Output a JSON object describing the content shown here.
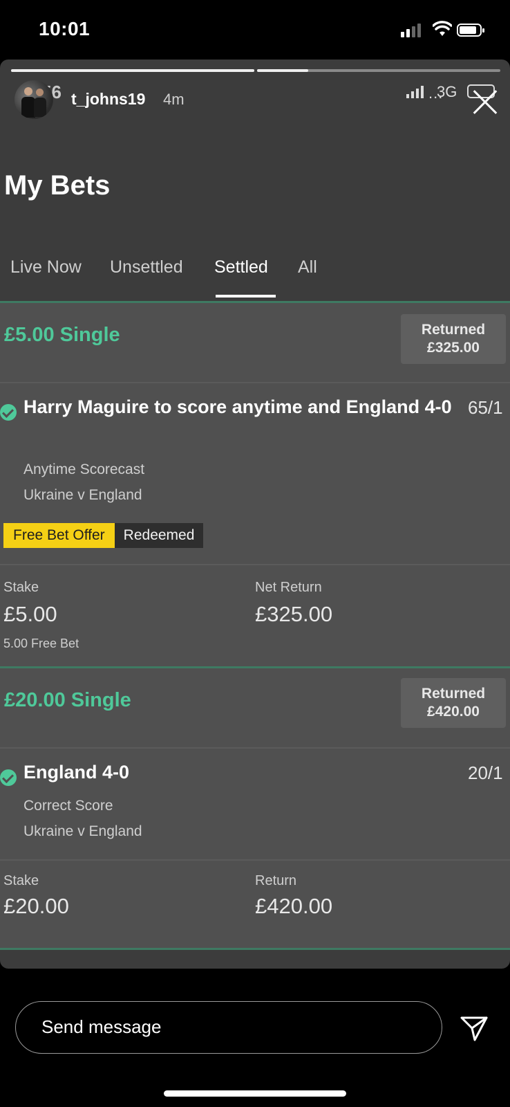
{
  "status_bar": {
    "time": "10:01"
  },
  "story": {
    "ghost_time": "56",
    "username": "t_johns19",
    "posted_ago": "4m",
    "ghost_network": "3G"
  },
  "app": {
    "title": "My Bets",
    "tabs": [
      "Live Now",
      "Unsettled",
      "Settled",
      "All"
    ],
    "active_tab": "Settled",
    "accent_color": "#4fc99a"
  },
  "bets": [
    {
      "title": "£5.00 Single",
      "status_label": "Returned",
      "status_amount": "£325.00",
      "selection": "Harry Maguire to score anytime and England 4-0",
      "odds": "65/1",
      "market": "Anytime Scorecast",
      "event": "Ukraine v England",
      "badge_offer": "Free Bet Offer",
      "badge_state": "Redeemed",
      "stake_label": "Stake",
      "stake_value": "£5.00",
      "stake_note": "5.00 Free Bet",
      "return_label": "Net Return",
      "return_value": "£325.00"
    },
    {
      "title": "£20.00 Single",
      "status_label": "Returned",
      "status_amount": "£420.00",
      "selection": "England 4-0",
      "odds": "20/1",
      "market": "Correct Score",
      "event": "Ukraine v England",
      "stake_label": "Stake",
      "stake_value": "£20.00",
      "return_label": "Return",
      "return_value": "£420.00"
    }
  ],
  "footer": {
    "message_placeholder": "Send message"
  }
}
